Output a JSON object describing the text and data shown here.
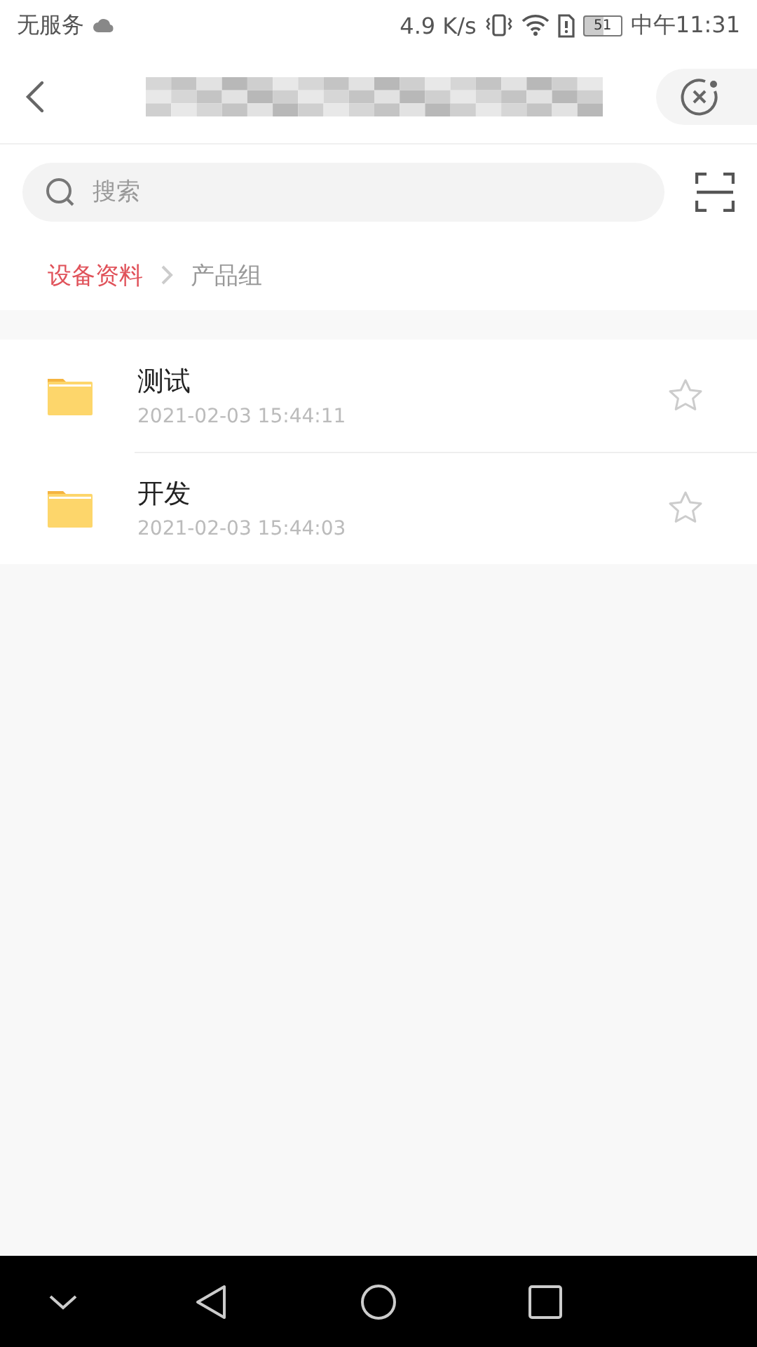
{
  "status_bar": {
    "carrier": "无服务",
    "speed": "4.9 K/s",
    "battery": "51",
    "time": "中午11:31"
  },
  "search": {
    "placeholder": "搜索"
  },
  "breadcrumb": [
    {
      "label": "设备资料",
      "selected": false
    },
    {
      "label": "产品组",
      "selected": true
    }
  ],
  "folders": [
    {
      "name": "测试",
      "date": "2021-02-03 15:44:11"
    },
    {
      "name": "开发",
      "date": "2021-02-03 15:44:03"
    }
  ]
}
